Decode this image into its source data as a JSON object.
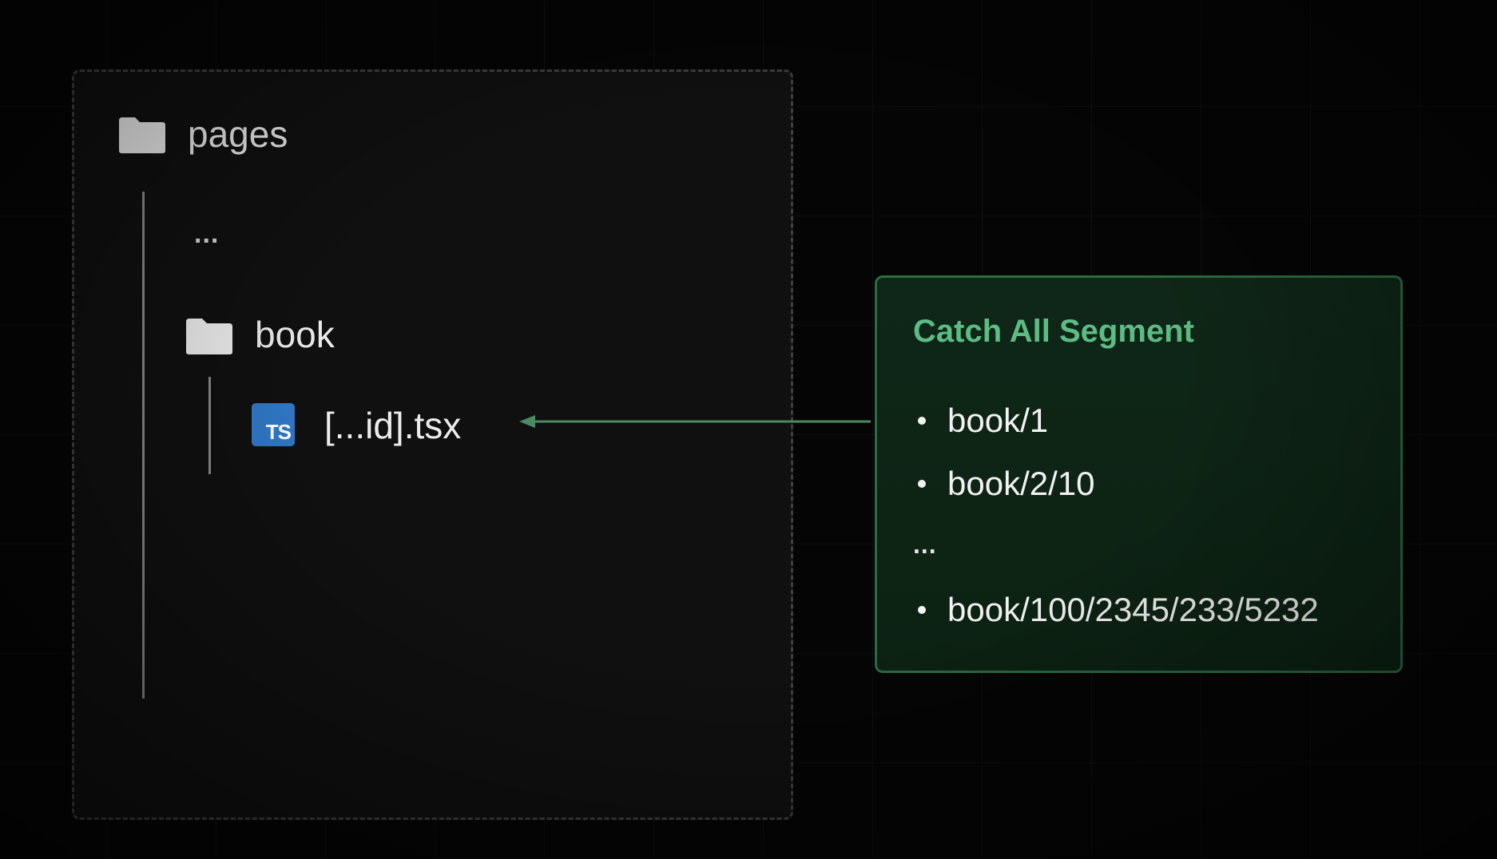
{
  "tree": {
    "root_folder": {
      "label": "pages",
      "icon": "folder-icon"
    },
    "ellipsis": "...",
    "sub_folder": {
      "label": "book",
      "icon": "folder-icon"
    },
    "file": {
      "label": "[...id].tsx",
      "icon": "typescript-file-icon",
      "badge": "TS"
    }
  },
  "card": {
    "title": "Catch All Segment",
    "items": [
      "book/1",
      "book/2/10",
      "book/100/2345/233/5232"
    ],
    "ellipsis": "..."
  },
  "colors": {
    "background": "#050505",
    "panel": "#101010",
    "panel_border": "#3f3f3f",
    "card_bg": "#0f2718",
    "card_border": "#2e6a43",
    "card_title": "#5dbb84",
    "arrow": "#4a8a63",
    "ts_badge": "#3178c6"
  }
}
